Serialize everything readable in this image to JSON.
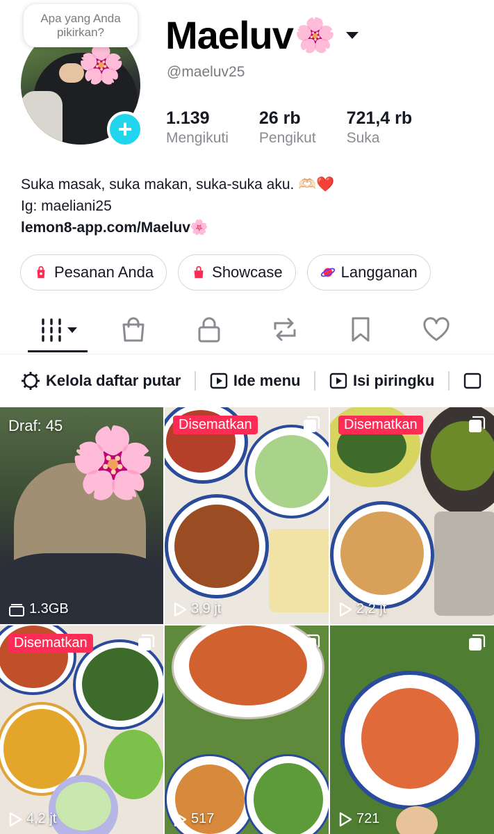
{
  "profile": {
    "thought_bubble": "Apa yang Anda pikirkan?",
    "display_name": "Maeluv",
    "display_name_emoji": "🌸",
    "username": "@maeluv25",
    "avatar_emoji": "🌸"
  },
  "stats": [
    {
      "value": "1.139",
      "label": "Mengikuti"
    },
    {
      "value": "26 rb",
      "label": "Pengikut"
    },
    {
      "value": "721,4 rb",
      "label": "Suka"
    }
  ],
  "bio": {
    "line1": "Suka masak, suka makan, suka-suka aku. 🫶🏻",
    "line1_heart": "❤️",
    "line2": "Ig: maeliani25",
    "link": "lemon8-app.com/Maeluv🌸"
  },
  "pills": [
    {
      "label": "Pesanan Anda",
      "icon": "shopping-bag-icon"
    },
    {
      "label": "Showcase",
      "icon": "shop-icon"
    },
    {
      "label": "Langganan",
      "icon": "planet-icon"
    }
  ],
  "tabs": [
    {
      "name": "videos-grid",
      "icon": "grid-icon"
    },
    {
      "name": "shop",
      "icon": "shopping-bag-icon"
    },
    {
      "name": "private",
      "icon": "lock-icon"
    },
    {
      "name": "reposts",
      "icon": "repost-icon"
    },
    {
      "name": "favorites",
      "icon": "bookmark-icon"
    },
    {
      "name": "liked",
      "icon": "heart-icon"
    }
  ],
  "playlists": [
    {
      "label": "Kelola daftar putar",
      "icon": "gear-icon"
    },
    {
      "label": "Ide menu",
      "icon": "play-icon"
    },
    {
      "label": "Isi piringku",
      "icon": "play-icon"
    }
  ],
  "grid": [
    {
      "draft_label": "Draf: 45",
      "bottom_text": "1.3GB",
      "bottom_icon": "storage-icon",
      "emoji": "🌸"
    },
    {
      "pinned": "Disematkan",
      "bottom_text": "3,9 jt",
      "bottom_icon": "play-icon"
    },
    {
      "pinned": "Disematkan",
      "bottom_text": "2,2 jt",
      "bottom_icon": "play-icon"
    },
    {
      "pinned": "Disematkan",
      "bottom_text": "4,2 jt",
      "bottom_icon": "play-icon"
    },
    {
      "bottom_text": "517",
      "bottom_icon": "play-icon"
    },
    {
      "bottom_text": "721",
      "bottom_icon": "play-icon"
    }
  ],
  "colors": {
    "accent_pink": "#fe2c55",
    "follow_cyan": "#20d5ec"
  }
}
